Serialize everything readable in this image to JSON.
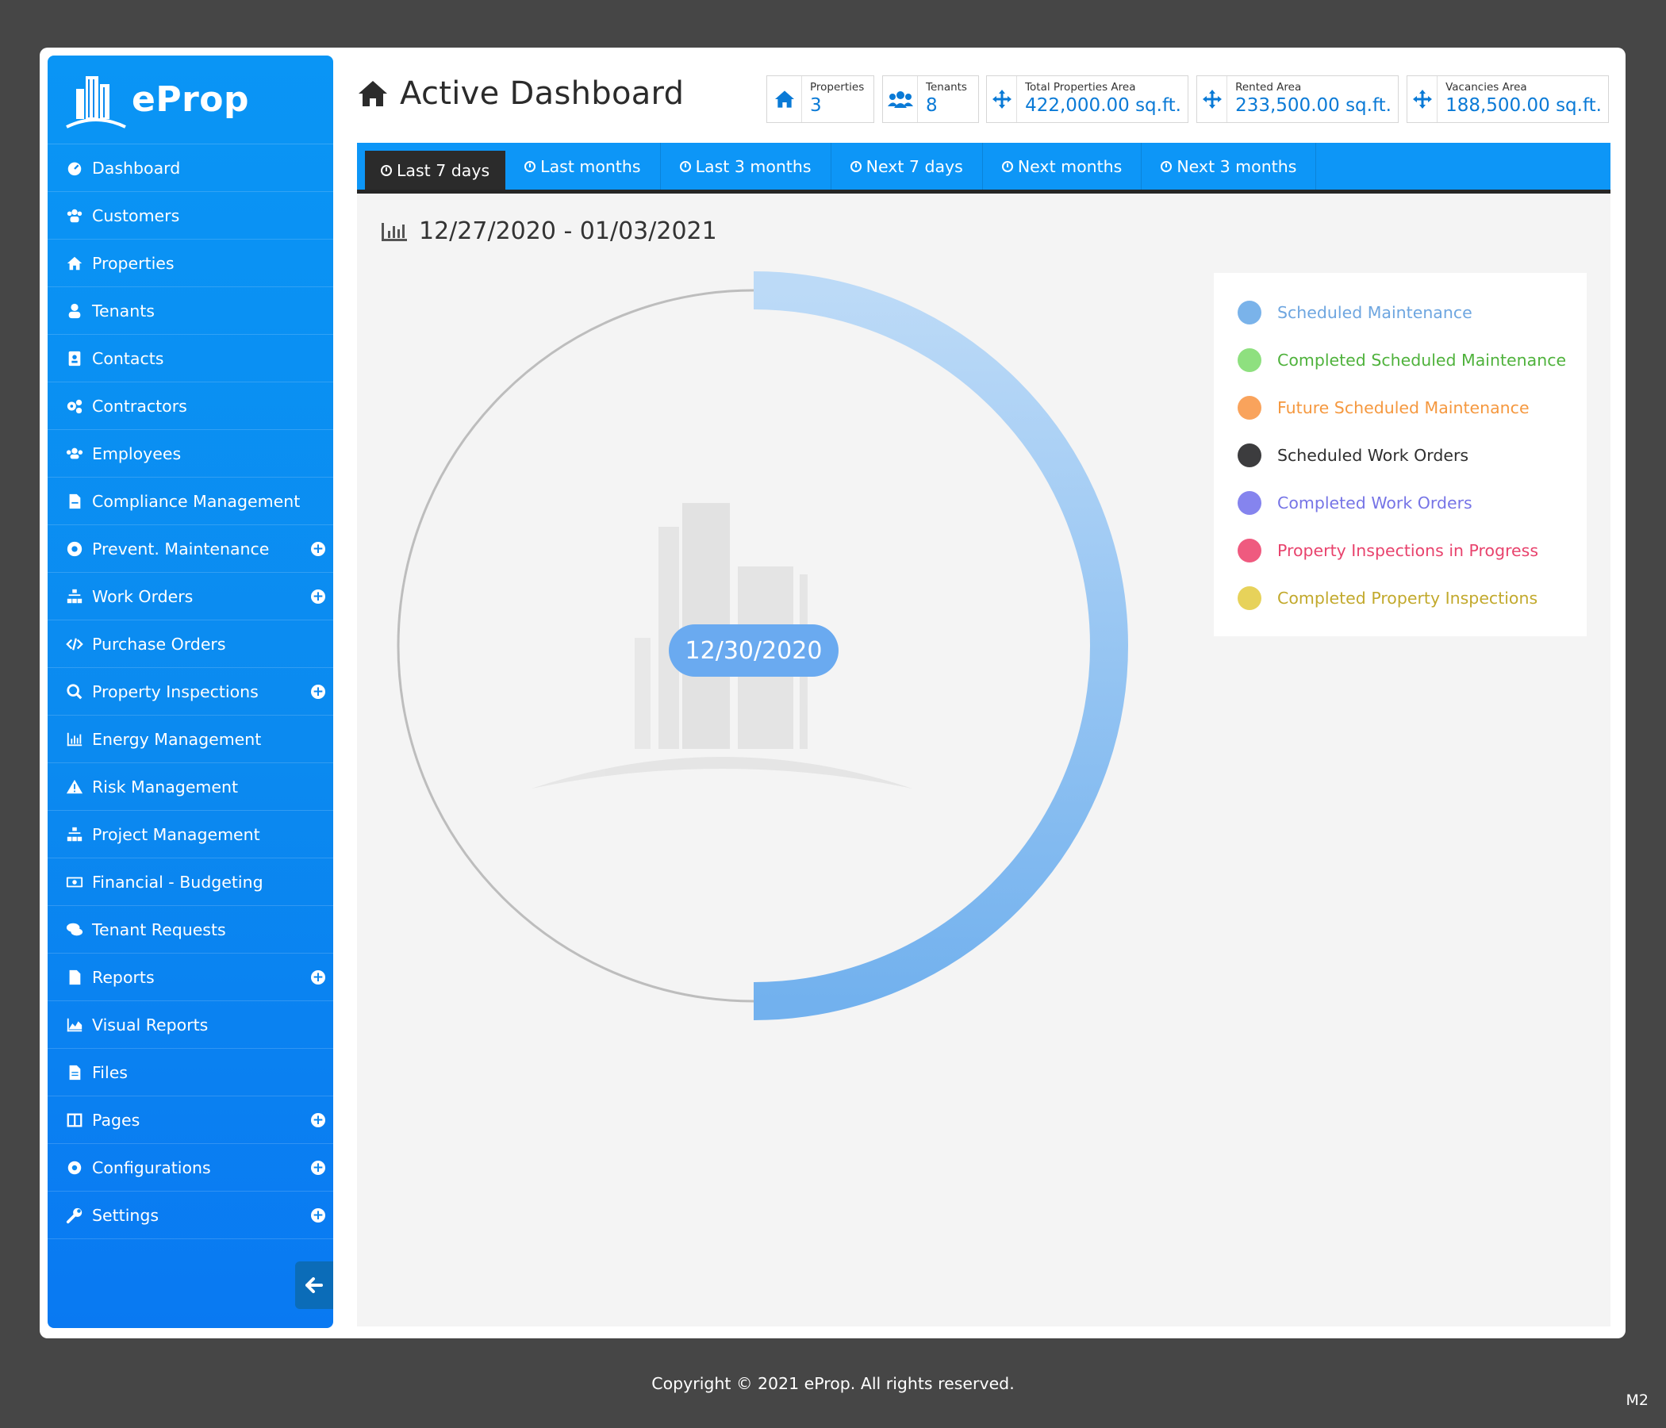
{
  "app": {
    "logo_text": "eProp"
  },
  "sidebar": {
    "items": [
      {
        "label": "Dashboard",
        "expandable": false
      },
      {
        "label": "Customers",
        "expandable": false
      },
      {
        "label": "Properties",
        "expandable": false
      },
      {
        "label": "Tenants",
        "expandable": false
      },
      {
        "label": "Contacts",
        "expandable": false
      },
      {
        "label": "Contractors",
        "expandable": false
      },
      {
        "label": "Employees",
        "expandable": false
      },
      {
        "label": "Compliance Management",
        "expandable": false
      },
      {
        "label": "Prevent. Maintenance",
        "expandable": true
      },
      {
        "label": "Work Orders",
        "expandable": true
      },
      {
        "label": "Purchase Orders",
        "expandable": false
      },
      {
        "label": "Property Inspections",
        "expandable": true
      },
      {
        "label": "Energy Management",
        "expandable": false
      },
      {
        "label": "Risk Management",
        "expandable": false
      },
      {
        "label": "Project Management",
        "expandable": false
      },
      {
        "label": "Financial - Budgeting",
        "expandable": false
      },
      {
        "label": "Tenant Requests",
        "expandable": false
      },
      {
        "label": "Reports",
        "expandable": true
      },
      {
        "label": "Visual Reports",
        "expandable": false
      },
      {
        "label": "Files",
        "expandable": false
      },
      {
        "label": "Pages",
        "expandable": true
      },
      {
        "label": "Configurations",
        "expandable": true
      },
      {
        "label": "Settings",
        "expandable": true
      }
    ]
  },
  "header": {
    "title": "Active Dashboard",
    "stats": [
      {
        "label": "Properties",
        "value": "3"
      },
      {
        "label": "Tenants",
        "value": "8"
      },
      {
        "label": "Total Properties Area",
        "value": "422,000.00 sq.ft."
      },
      {
        "label": "Rented Area",
        "value": "233,500.00 sq.ft."
      },
      {
        "label": "Vacancies Area",
        "value": "188,500.00 sq.ft."
      }
    ]
  },
  "tabs": [
    {
      "label": "Last 7 days",
      "active": true
    },
    {
      "label": "Last months",
      "active": false
    },
    {
      "label": "Last 3 months",
      "active": false
    },
    {
      "label": "Next 7 days",
      "active": false
    },
    {
      "label": "Next months",
      "active": false
    },
    {
      "label": "Next 3 months",
      "active": false
    }
  ],
  "dashboard": {
    "date_range": "12/27/2020 - 01/03/2021",
    "center_date": "12/30/2020",
    "progress_fraction": 0.5
  },
  "legend": [
    {
      "label": "Scheduled Maintenance",
      "color": "#7ab3ea",
      "text_color": "#6ea6e0"
    },
    {
      "label": "Completed Scheduled Maintenance",
      "color": "#8ee07f",
      "text_color": "#4fb23c"
    },
    {
      "label": "Future Scheduled Maintenance",
      "color": "#f9a35c",
      "text_color": "#f5983f"
    },
    {
      "label": "Scheduled Work Orders",
      "color": "#3c3c3e",
      "text_color": "#2f2f2f"
    },
    {
      "label": "Completed Work Orders",
      "color": "#8584ee",
      "text_color": "#7674e6"
    },
    {
      "label": "Property Inspections in Progress",
      "color": "#ef5a7f",
      "text_color": "#e8436d"
    },
    {
      "label": "Completed Property Inspections",
      "color": "#e7d25a",
      "text_color": "#c2a92c"
    }
  ],
  "footer": {
    "copyright": "Copyright  ©  2021   eProp.   All rights reserved.",
    "version": "M2"
  },
  "colors": {
    "brand_blue": "#0d96f7",
    "accent_value": "#0a7ad6",
    "active_tab": "#2b2b2b"
  }
}
